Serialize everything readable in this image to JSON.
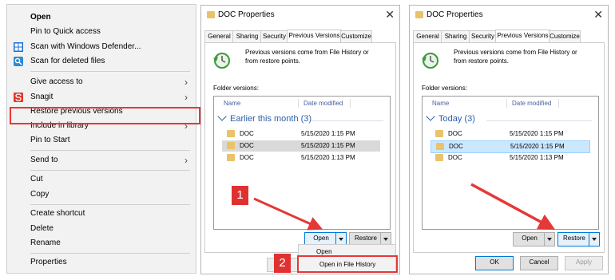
{
  "context_menu": {
    "items": [
      {
        "label": "Open",
        "bold": true
      },
      {
        "label": "Pin to Quick access"
      },
      {
        "label": "Scan with Windows Defender...",
        "icon": "windows-defender-icon"
      },
      {
        "label": "Scan for deleted files",
        "icon": "scan-deleted-files-icon"
      },
      {
        "label": "Give access to",
        "submenu": true
      },
      {
        "label": "Snagit",
        "icon": "snagit-icon",
        "submenu": true
      },
      {
        "label": "Restore previous versions",
        "highlighted": true
      },
      {
        "label": "Include in library",
        "submenu": true
      },
      {
        "label": "Pin to Start"
      },
      {
        "label": "Send to",
        "submenu": true
      },
      {
        "label": "Cut"
      },
      {
        "label": "Copy"
      },
      {
        "label": "Create shortcut"
      },
      {
        "label": "Delete"
      },
      {
        "label": "Rename"
      },
      {
        "label": "Properties"
      }
    ],
    "highlight_color": "#e53838"
  },
  "dialog_left": {
    "title": "DOC Properties",
    "close": "✕",
    "tabs": [
      "General",
      "Sharing",
      "Security",
      "Previous Versions",
      "Customize"
    ],
    "active_tab": "Previous Versions",
    "description": "Previous versions come from File History or from restore points.",
    "folder_versions_label": "Folder versions:",
    "columns": {
      "name": "Name",
      "date": "Date modified"
    },
    "group": "Earlier this month (3)",
    "rows": [
      {
        "name": "DOC",
        "date": "5/15/2020 1:15 PM",
        "selected": false
      },
      {
        "name": "DOC",
        "date": "5/15/2020 1:15 PM",
        "selected": true
      },
      {
        "name": "DOC",
        "date": "5/15/2020 1:13 PM",
        "selected": false
      }
    ],
    "open_button": "Open",
    "restore_button": "Restore",
    "dropdown_items": [
      "Open",
      "Open in File History"
    ],
    "step1": "1",
    "step2": "2"
  },
  "dialog_right": {
    "title": "DOC Properties",
    "close": "✕",
    "tabs": [
      "General",
      "Sharing",
      "Security",
      "Previous Versions",
      "Customize"
    ],
    "active_tab": "Previous Versions",
    "description": "Previous versions come from File History or from restore points.",
    "folder_versions_label": "Folder versions:",
    "columns": {
      "name": "Name",
      "date": "Date modified"
    },
    "group": "Today (3)",
    "rows": [
      {
        "name": "DOC",
        "date": "5/15/2020 1:15 PM",
        "selected": false
      },
      {
        "name": "DOC",
        "date": "5/15/2020 1:15 PM",
        "selected": true
      },
      {
        "name": "DOC",
        "date": "5/15/2020 1:13 PM",
        "selected": false
      }
    ],
    "open_button": "Open",
    "restore_button": "Restore",
    "ok_button": "OK",
    "cancel_button": "Cancel",
    "apply_button": "Apply"
  },
  "colors": {
    "accent_red": "#e53838",
    "selection_blue": "#cce8ff",
    "group_blue": "#2d5ea8",
    "folder_yellow": "#e9c36b"
  }
}
